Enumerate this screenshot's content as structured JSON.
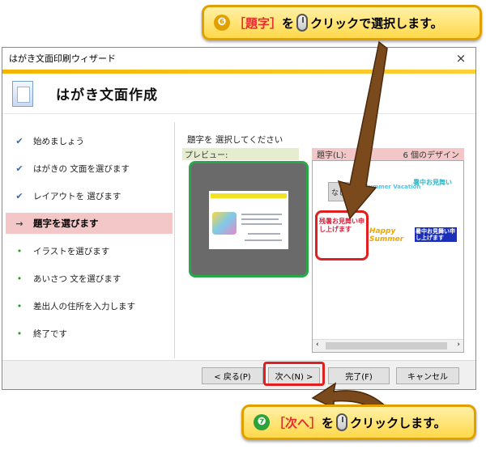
{
  "callouts": {
    "top": {
      "number": "❻",
      "open": "［",
      "target": "題字",
      "close": "］",
      "mid": " を",
      "action": "クリックで選択します。"
    },
    "bottom": {
      "number": "❼",
      "open": "［",
      "target": "次へ",
      "close": "］",
      "mid": " を",
      "action": "クリックします。"
    }
  },
  "window": {
    "title": "はがき文面印刷ウィザード",
    "close": "×",
    "header_title": "はがき文面作成"
  },
  "steps": [
    {
      "mark": "✔",
      "label": "始めましょう"
    },
    {
      "mark": "✔",
      "label": "はがきの 文面を選びます"
    },
    {
      "mark": "✔",
      "label": "レイアウトを 選びます"
    },
    {
      "mark": "→",
      "label": "題字を選びます"
    },
    {
      "mark": "•",
      "label": "イラストを選びます"
    },
    {
      "mark": "•",
      "label": "あいさつ 文を選びます"
    },
    {
      "mark": "•",
      "label": "差出人の住所を入力します"
    },
    {
      "mark": "•",
      "label": "終了です"
    }
  ],
  "main": {
    "prompt": "題字を 選択してください",
    "preview_label": "プレビュー:",
    "design_label": "題字(L):",
    "design_count": "6 個のデザイン",
    "none_label": "なし",
    "tiles": [
      "Summer Vacation",
      "暑中お見舞い",
      "残暑お見舞い申し上げます",
      "Happy Summer",
      "暑中お見舞い申し上げます"
    ]
  },
  "footer": {
    "back": "< 戻る(P)",
    "next": "次へ(N) >",
    "finish": "完了(F)",
    "cancel": "キャンセル"
  },
  "colors": {
    "accent_orange": "#e2a000",
    "highlight_red": "#e02020",
    "preview_green": "#29a84a",
    "active_step": "#f3c7c7"
  }
}
